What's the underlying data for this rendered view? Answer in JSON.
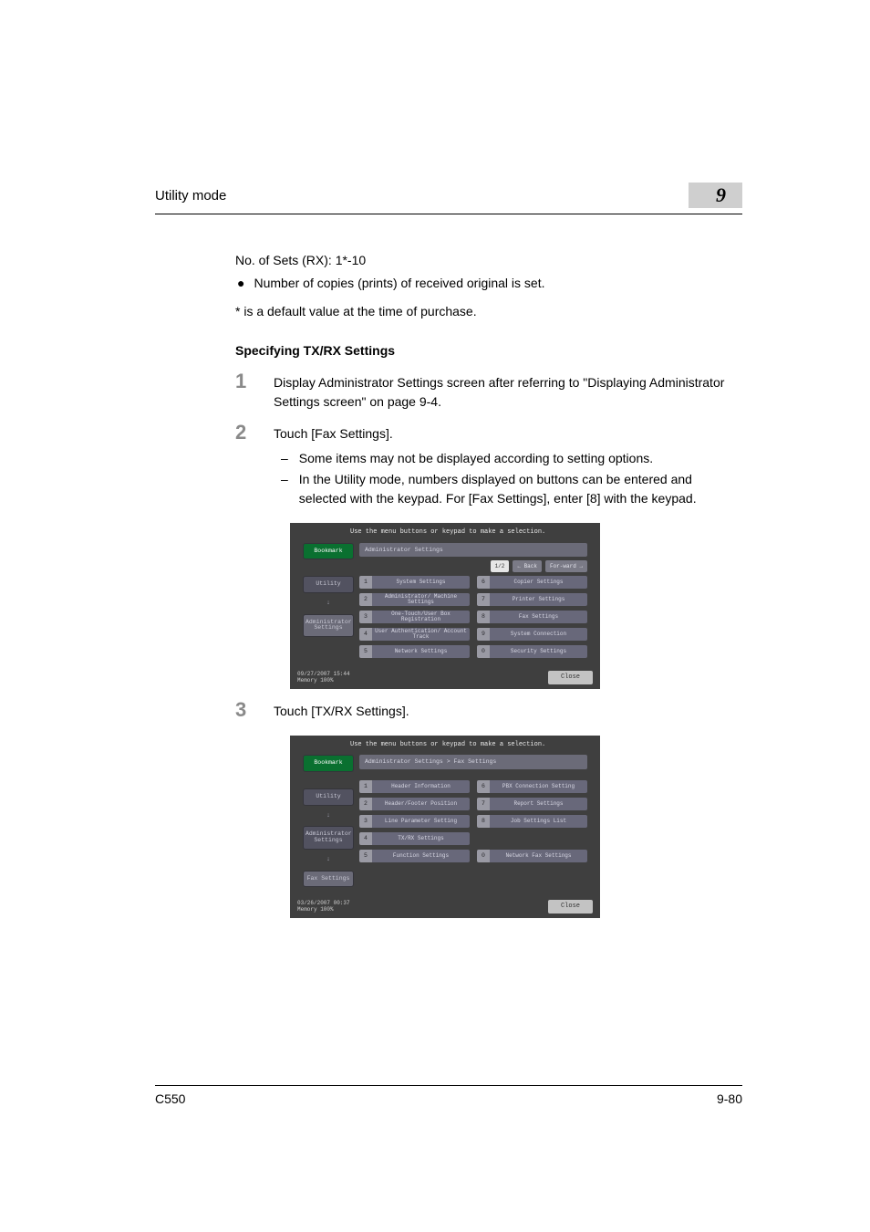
{
  "header": {
    "title": "Utility mode",
    "chapter": "9"
  },
  "body": {
    "sets_line": "No. of Sets (RX): 1*-10",
    "bullet1": "Number of copies (prints) of received original is set.",
    "default_note": "* is a default value at the time of purchase.",
    "section_heading": "Specifying TX/RX Settings",
    "steps": {
      "1": {
        "num": "1",
        "text": "Display Administrator Settings screen after referring to \"Displaying Administrator Settings screen\" on page 9-4."
      },
      "2": {
        "num": "2",
        "text": "Touch [Fax Settings].",
        "sub1": "Some items may not be displayed according to setting options.",
        "sub2": "In the Utility mode, numbers displayed on buttons can be entered and selected with the keypad. For [Fax Settings], enter [8] with the keypad."
      },
      "3": {
        "num": "3",
        "text": "Touch [TX/RX Settings]."
      }
    }
  },
  "screen1": {
    "msg": "Use the menu buttons or keypad to make a selection.",
    "side": {
      "bookmark": "Bookmark",
      "utility": "Utility",
      "admin": "Administrator Settings"
    },
    "bc": "Administrator Settings",
    "nav": {
      "page": "1/2",
      "back": "← Back",
      "fwd": "For-ward →"
    },
    "cells": [
      {
        "n": "1",
        "l": "System Settings"
      },
      {
        "n": "6",
        "l": "Copier Settings"
      },
      {
        "n": "2",
        "l": "Administrator/ Machine Settings"
      },
      {
        "n": "7",
        "l": "Printer Settings"
      },
      {
        "n": "3",
        "l": "One-Touch/User Box Registration"
      },
      {
        "n": "8",
        "l": "Fax Settings"
      },
      {
        "n": "4",
        "l": "User Authentication/ Account Track"
      },
      {
        "n": "9",
        "l": "System Connection"
      },
      {
        "n": "5",
        "l": "Network Settings"
      },
      {
        "n": "0",
        "l": "Security Settings"
      }
    ],
    "foot": {
      "dt": "09/27/2007   15:44",
      "mem": "Memory      100%",
      "close": "Close"
    }
  },
  "screen2": {
    "msg": "Use the menu buttons or keypad to make a selection.",
    "side": {
      "bookmark": "Bookmark",
      "utility": "Utility",
      "admin": "Administrator Settings",
      "fax": "Fax Settings"
    },
    "bc": "Administrator Settings  > Fax Settings",
    "cells": [
      {
        "n": "1",
        "l": "Header Information"
      },
      {
        "n": "6",
        "l": "PBX Connection Setting"
      },
      {
        "n": "2",
        "l": "Header/Footer Position"
      },
      {
        "n": "7",
        "l": "Report Settings"
      },
      {
        "n": "3",
        "l": "Line Parameter Setting"
      },
      {
        "n": "8",
        "l": "Job Settings List"
      },
      {
        "n": "4",
        "l": "TX/RX Settings"
      },
      {
        "n": "",
        "l": ""
      },
      {
        "n": "5",
        "l": "Function Settings"
      },
      {
        "n": "0",
        "l": "Network Fax Settings"
      }
    ],
    "foot": {
      "dt": "03/26/2007   00:37",
      "mem": "Memory      100%",
      "close": "Close"
    }
  },
  "footer": {
    "left": "C550",
    "right": "9-80"
  }
}
